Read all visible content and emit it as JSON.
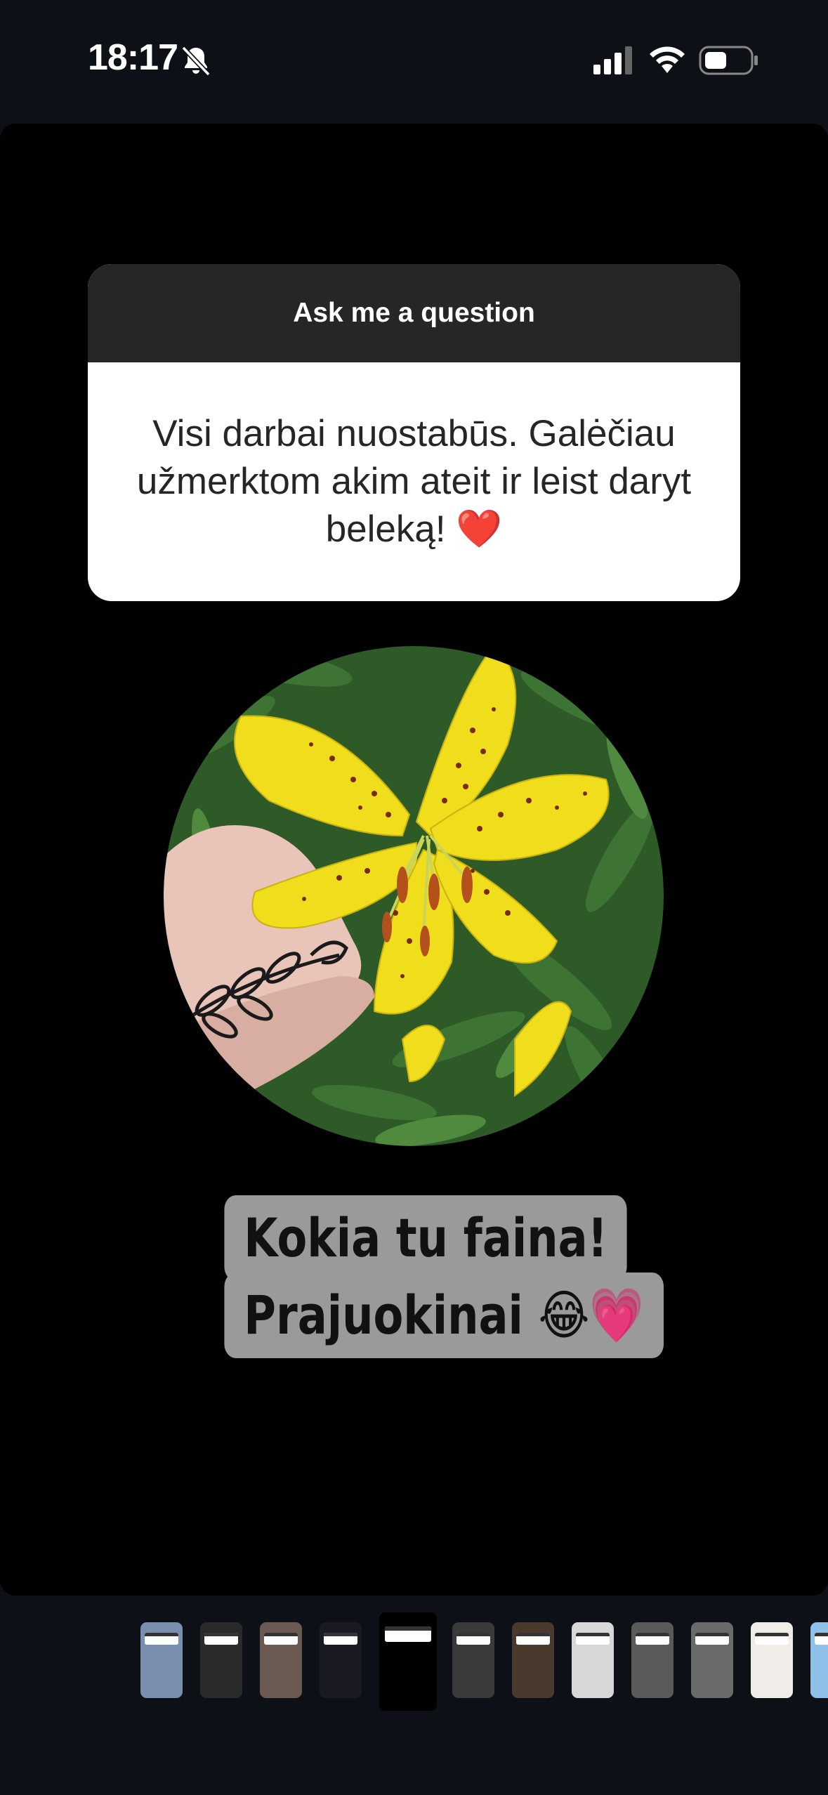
{
  "status_bar": {
    "time": "18:17"
  },
  "question_sticker": {
    "header": "Ask me a question",
    "question": "Visi darbai nuostabūs. Galėčiau užmerktom akim ateit ir leist daryt beleką! ❤️"
  },
  "reply_text": {
    "line1": "Kokia tu faina!",
    "line2": "Prajuokinai 😂💗"
  },
  "story_thumbnails": [
    {
      "id": "thumb-1",
      "active": false
    },
    {
      "id": "thumb-2",
      "active": false
    },
    {
      "id": "thumb-3",
      "active": false
    },
    {
      "id": "thumb-4",
      "active": false
    },
    {
      "id": "thumb-5",
      "active": true
    },
    {
      "id": "thumb-6",
      "active": false
    },
    {
      "id": "thumb-7",
      "active": false
    },
    {
      "id": "thumb-8",
      "active": false
    },
    {
      "id": "thumb-9",
      "active": false
    },
    {
      "id": "thumb-10",
      "active": false
    },
    {
      "id": "thumb-11",
      "active": false
    },
    {
      "id": "thumb-12",
      "active": false
    }
  ],
  "colors": {
    "background": "#0d1117",
    "sticker_header": "#262626",
    "reply_bubble": "#9a9a9a",
    "lily": "#f2e01a"
  }
}
